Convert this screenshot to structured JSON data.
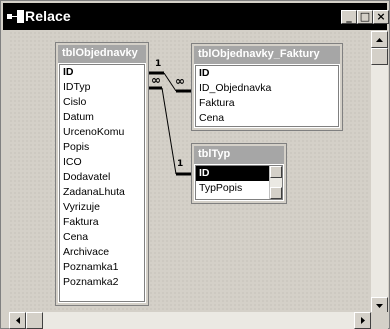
{
  "window": {
    "title": "Relace",
    "controls": {
      "minimize": "_",
      "maximize": "□",
      "close": "×"
    }
  },
  "tables": [
    {
      "name": "tblObjednavky",
      "fields": [
        "ID",
        "IDTyp",
        "Cislo",
        "Datum",
        "UrcenoKomu",
        "Popis",
        "ICO",
        "Dodavatel",
        "ZadanaLhuta",
        "Vyrizuje",
        "Faktura",
        "Cena",
        "Archivace",
        "Poznamka1",
        "Poznamka2"
      ]
    },
    {
      "name": "tblObjednavky_Faktury",
      "fields": [
        "ID",
        "ID_Objednavka",
        "Faktura",
        "Cena"
      ]
    },
    {
      "name": "tblTyp",
      "fields": [
        "ID",
        "TypPopis"
      ]
    }
  ],
  "relationships": [
    {
      "from_table": "tblObjednavky",
      "from_field": "ID",
      "to_table": "tblObjednavky_Faktury",
      "to_field": "ID_Objednavka",
      "from_symbol": "1",
      "to_symbol": "∞"
    },
    {
      "from_table": "tblTyp",
      "from_field": "ID",
      "to_table": "tblObjednavky",
      "to_field": "IDTyp",
      "from_symbol": "1",
      "to_symbol": "∞"
    }
  ],
  "icons": [
    "relationships-window-icon"
  ]
}
